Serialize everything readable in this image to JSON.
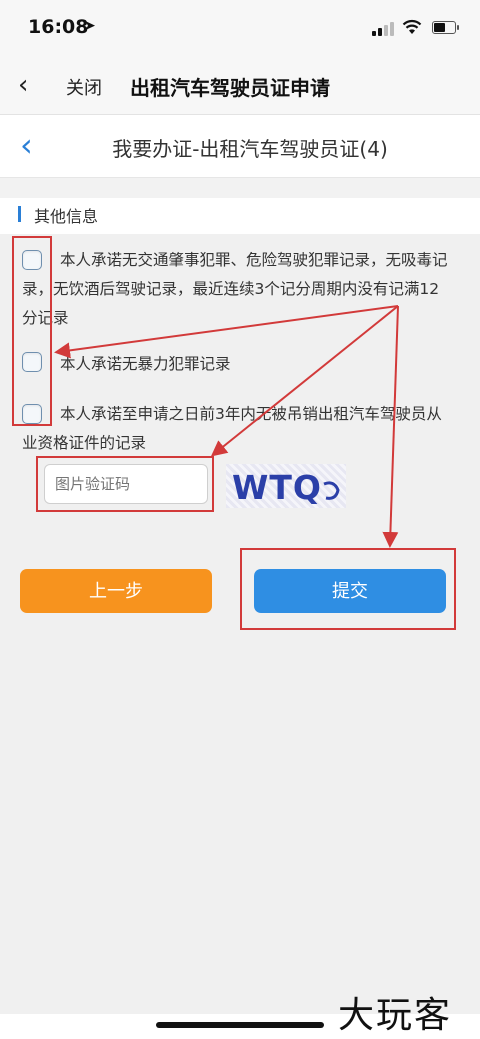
{
  "status_bar": {
    "time": "16:08"
  },
  "nav": {
    "back_glyph": "‹",
    "close_label": "关闭",
    "title": "出租汽车驾驶员证申请"
  },
  "page": {
    "back_glyph": "‹",
    "title": "我要办证-出租汽车驾驶员证(4)"
  },
  "section": {
    "title": "其他信息"
  },
  "checks": [
    {
      "label": "本人承诺无交通肇事犯罪、危险驾驶犯罪记录，无吸毒记录，无饮酒后驾驶记录，最近连续3个记分周期内没有记满12分记录",
      "checked": false
    },
    {
      "label": "本人承诺无暴力犯罪记录",
      "checked": false
    },
    {
      "label": "本人承诺至申请之日前3年内无被吊销出租汽车驾驶员从业资格证件的记录",
      "checked": false
    }
  ],
  "captcha": {
    "placeholder": "图片验证码",
    "image_text": "WTQ"
  },
  "buttons": {
    "prev_label": "上一步",
    "submit_label": "提交"
  },
  "watermark": "大玩客",
  "colors": {
    "accent": "#2a7fd6",
    "prev": "#f7931e",
    "submit": "#2f8ee3",
    "annotation": "#d23a3a"
  }
}
